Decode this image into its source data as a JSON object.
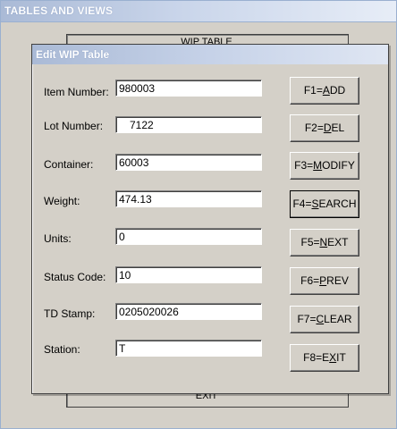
{
  "outer_window": {
    "title": "TABLES AND VIEWS"
  },
  "background": {
    "top_label": "WIP TABLE",
    "bottom_label": "EXIT"
  },
  "dialog": {
    "title": "Edit WIP Table",
    "fields": [
      {
        "label": "Item Number:",
        "value": "980003"
      },
      {
        "label": "Lot Number:",
        "value": "7122"
      },
      {
        "label": "Container:",
        "value": "60003"
      },
      {
        "label": "Weight:",
        "value": "474.13"
      },
      {
        "label": "Units:",
        "value": "0"
      },
      {
        "label": "Status Code:",
        "value": "10"
      },
      {
        "label": "TD Stamp:",
        "value": "0205020026"
      },
      {
        "label": "Station:",
        "value": "T"
      }
    ],
    "buttons": [
      {
        "prefix": "F1=",
        "accel": "A",
        "rest": "DD"
      },
      {
        "prefix": "F2=",
        "accel": "D",
        "rest": "EL"
      },
      {
        "prefix": "F3=",
        "accel": "M",
        "rest": "ODIFY"
      },
      {
        "prefix": "F4=",
        "accel": "S",
        "rest": "EARCH"
      },
      {
        "prefix": "F5=",
        "accel": "N",
        "rest": "EXT"
      },
      {
        "prefix": "F6=",
        "accel": "P",
        "rest": "REV"
      },
      {
        "prefix": "F7=",
        "accel": "C",
        "rest": "LEAR"
      },
      {
        "prefix": "F8=E",
        "accel": "X",
        "rest": "IT"
      }
    ]
  }
}
